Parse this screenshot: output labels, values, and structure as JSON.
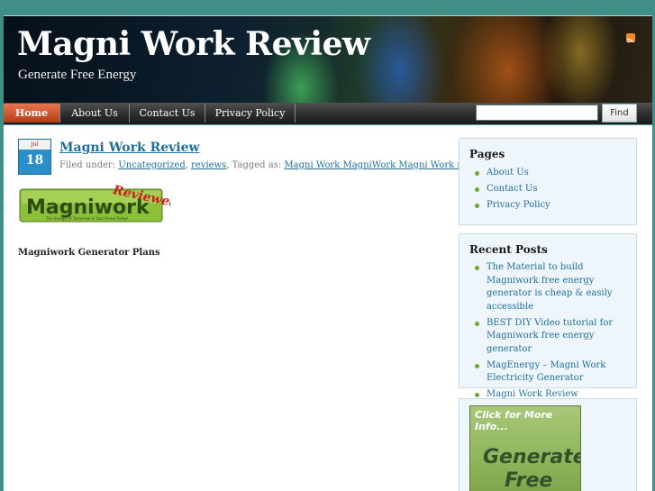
{
  "header": {
    "title": "Magni Work Review",
    "description": "Generate Free Energy"
  },
  "nav": {
    "items": [
      {
        "label": "Home",
        "active": true
      },
      {
        "label": "About Us",
        "active": false
      },
      {
        "label": "Contact Us",
        "active": false
      },
      {
        "label": "Privacy Policy",
        "active": false
      }
    ],
    "search": {
      "value": "",
      "placeholder": "",
      "button_label": "Find"
    }
  },
  "post": {
    "date": {
      "month": "Jul",
      "day": "18"
    },
    "title": "Magni Work Review",
    "meta": {
      "filed_prefix": "Filed under:",
      "categories": [
        "Uncategorized",
        "reviews"
      ],
      "tagged_prefix": "Tagged as:",
      "tags": "Magni Work MagniWork Magni Work review"
    },
    "logo": {
      "word": "Magniwork",
      "stamp": "Reviewed",
      "tagline": "The Energy Of Tomorrow In Your Home Today!"
    },
    "body_text": "Magniwork Generator Plans"
  },
  "sidebar": {
    "pages": {
      "title": "Pages",
      "items": [
        "About Us",
        "Contact Us",
        "Privacy Policy"
      ]
    },
    "recent_posts": {
      "title": "Recent Posts",
      "items": [
        "The Material to build Magniwork free energy generator is cheap & easily accessible",
        "BEST DIY Video tutorial for Magniwork free energy generator",
        "MagEnergy – Magni Work Electricity Generator",
        "Magni Work Review"
      ]
    },
    "banner": {
      "line1": "Click for More Info...",
      "line2": "Generate",
      "line3": "Free"
    }
  },
  "colors": {
    "page_background": "#3f8f86",
    "link": "#1d6f9e",
    "nav_active": "#d4582e",
    "bullet": "#6aa832"
  }
}
